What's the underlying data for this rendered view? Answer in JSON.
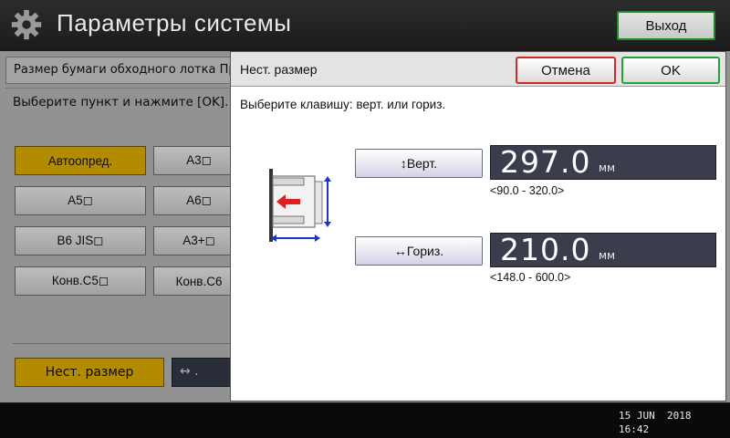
{
  "header": {
    "title": "Параметры системы",
    "exit_label": "Выход"
  },
  "background": {
    "tab_label": "Размер бумаги обходного лотка При",
    "instruction": "Выберите пункт и нажмите [OK].",
    "paper_buttons": [
      {
        "label": "Автоопред.",
        "selected": true
      },
      {
        "label": "A3◻",
        "selected": false
      },
      {
        "label": "A5◻",
        "selected": false
      },
      {
        "label": "A6◻",
        "selected": false
      },
      {
        "label": "B6 JIS◻",
        "selected": false
      },
      {
        "label": "A3+◻",
        "selected": false
      },
      {
        "label": "Конв.C5◻",
        "selected": false
      },
      {
        "label": "Конв.C6",
        "selected": false
      }
    ],
    "custom_size_label": "Нест. размер",
    "custom_field_value": "↔    ."
  },
  "dialog": {
    "title": "Нест. размер",
    "cancel_label": "Отмена",
    "ok_label": "OK",
    "instruction": "Выберите клавишу: верт. или гориз.",
    "vertical": {
      "button_label": "↕Верт.",
      "value": "297.0",
      "unit": "мм",
      "range": "<90.0 - 320.0>"
    },
    "horizontal": {
      "button_label": "↔Гориз.",
      "value": "210.0",
      "unit": "мм",
      "range": "<148.0 - 600.0>"
    }
  },
  "status": {
    "date": "15 JUN  2018",
    "time": "16:42"
  },
  "colors": {
    "selected_yellow": "#e5b300",
    "cancel_border": "#cf2a2a",
    "ok_border": "#22a33a",
    "display_bg": "#3a3d4c"
  }
}
